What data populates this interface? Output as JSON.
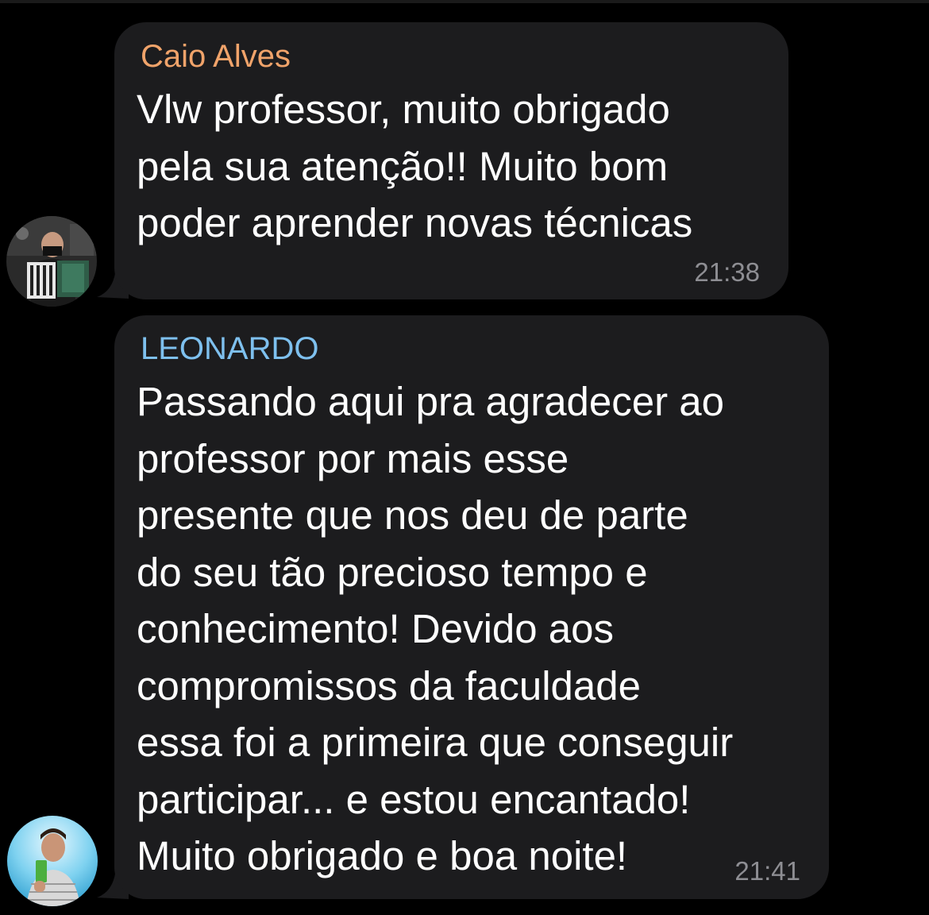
{
  "messages": [
    {
      "sender": "Caio Alves",
      "text": "Vlw professor, muito obrigado\npela sua atenção!! Muito bom\npoder aprender novas técnicas",
      "time": "21:38"
    },
    {
      "sender": "LEONARDO",
      "text": "Passando aqui pra agradecer ao\nprofessor por mais esse\npresente que nos deu de parte\ndo seu tão precioso tempo e\nconhecimento! Devido aos\ncompromissos da faculdade\nessa foi a primeira que conseguir\nparticipar... e estou encantado!\nMuito obrigado e boa noite!",
      "time": "21:41"
    }
  ],
  "colors": {
    "background": "#000000",
    "bubble": "#1c1c1e",
    "sender_1": "#f0a36a",
    "sender_2": "#7ec0ee",
    "text": "#ffffff",
    "timestamp": "#8e8e93"
  },
  "icons": [
    "avatar-photo-accordion-player",
    "avatar-photo-selfie"
  ]
}
